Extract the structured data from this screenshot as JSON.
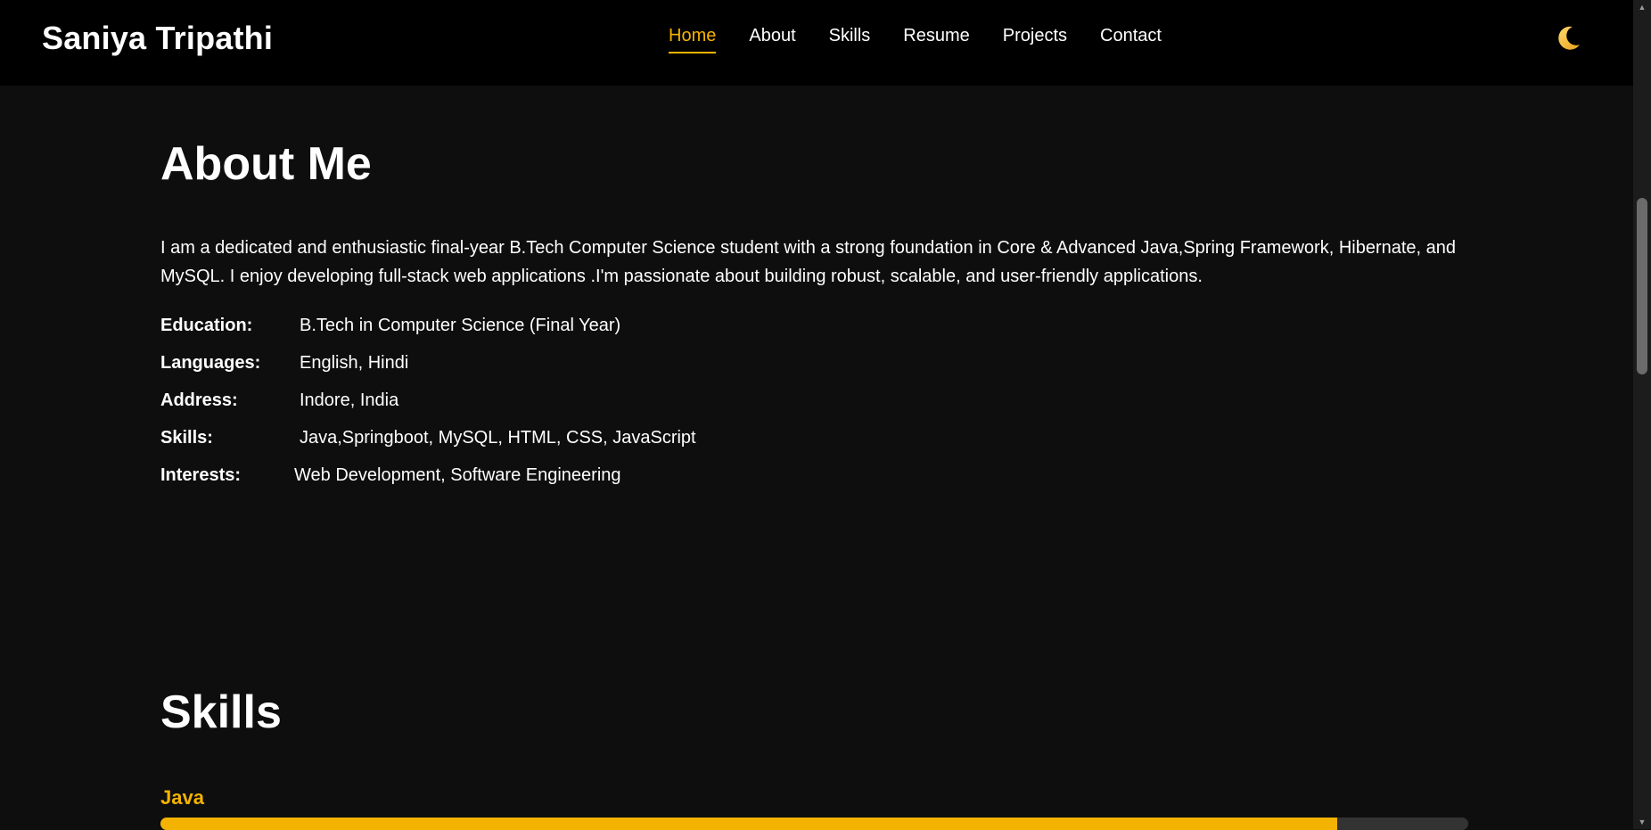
{
  "header": {
    "brand": "Saniya Tripathi",
    "nav": [
      {
        "label": "Home",
        "active": true
      },
      {
        "label": "About",
        "active": false
      },
      {
        "label": "Skills",
        "active": false
      },
      {
        "label": "Resume",
        "active": false
      },
      {
        "label": "Projects",
        "active": false
      },
      {
        "label": "Contact",
        "active": false
      }
    ],
    "theme_toggle_icon": "moon-icon"
  },
  "about": {
    "title": "About Me",
    "paragraph": "I am a dedicated and enthusiastic final-year B.Tech Computer Science student with a strong foundation in Core & Advanced Java,Spring Framework, Hibernate, and MySQL. I enjoy developing full-stack web applications .I'm passionate about building robust, scalable, and user-friendly applications.",
    "info": [
      {
        "label": "Education:",
        "value": "B.Tech in Computer Science (Final Year)"
      },
      {
        "label": "Languages:",
        "value": "English, Hindi"
      },
      {
        "label": "Address:",
        "value": "Indore, India"
      },
      {
        "label": "Skills:",
        "value": "Java,Springboot, MySQL, HTML, CSS, JavaScript"
      },
      {
        "label": "Interests:",
        "value": "Web Development, Software Engineering"
      }
    ]
  },
  "skills": {
    "title": "Skills",
    "items": [
      {
        "name": "Java",
        "level_percent": 90
      }
    ]
  },
  "colors": {
    "accent": "#f5b301",
    "background": "#0e0e0e",
    "header_background": "#000000",
    "bar_track": "#333333"
  }
}
